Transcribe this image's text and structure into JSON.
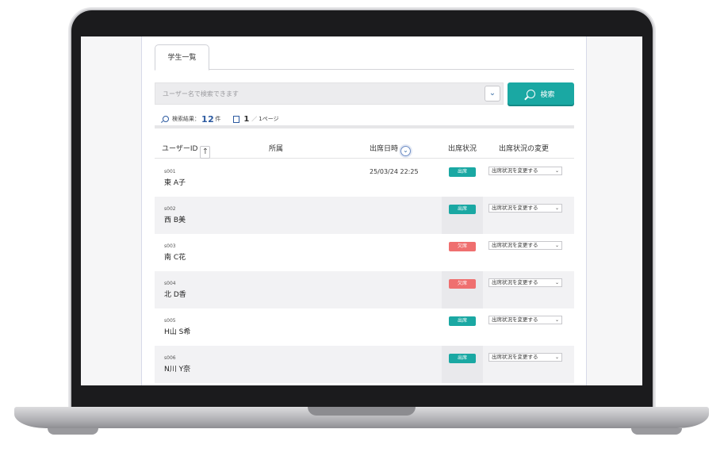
{
  "tab": {
    "label": "学生一覧"
  },
  "search": {
    "placeholder": "ユーザー名で検索できます",
    "dropdown_icon": "chevron-down-icon",
    "button_label": "検索"
  },
  "meta": {
    "result_label": "検索結果：",
    "result_count": "12",
    "result_unit": "件",
    "page_current": "1",
    "page_total": "1ページ",
    "page_sep": "／"
  },
  "table": {
    "headers": {
      "user_id": "ユーザーID",
      "sort_up": "↑",
      "affiliation": "所属",
      "datetime": "出席日時",
      "sort_down": "⌄",
      "status": "出席状況",
      "change": "出席状況の変更"
    },
    "rows": [
      {
        "uid": "s001",
        "name": "東 A子",
        "datetime": "25/03/24 22:25",
        "status": "出席",
        "status_type": "present",
        "select": "出席状況を変更する"
      },
      {
        "uid": "s002",
        "name": "西 B美",
        "datetime": "",
        "status": "出席",
        "status_type": "present",
        "select": "出席状況を変更する"
      },
      {
        "uid": "s003",
        "name": "南 C花",
        "datetime": "",
        "status": "欠席",
        "status_type": "absent",
        "select": "出席状況を変更する"
      },
      {
        "uid": "s004",
        "name": "北 D香",
        "datetime": "",
        "status": "欠席",
        "status_type": "absent",
        "select": "出席状況を変更する"
      },
      {
        "uid": "s005",
        "name": "H山 S希",
        "datetime": "",
        "status": "出席",
        "status_type": "present",
        "select": "出席状況を変更する"
      },
      {
        "uid": "s006",
        "name": "N川 Y奈",
        "datetime": "",
        "status": "出席",
        "status_type": "present",
        "select": "出席状況を変更する"
      }
    ]
  },
  "colors": {
    "accent": "#1aa8a3",
    "absent": "#ef6f6f",
    "link": "#2c5aa0"
  }
}
